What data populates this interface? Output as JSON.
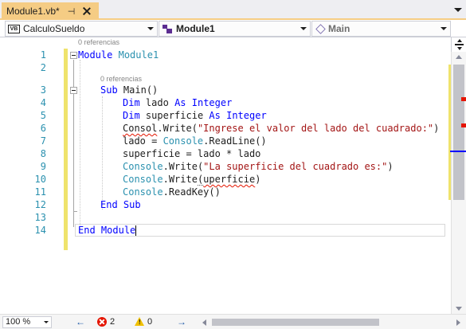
{
  "tab": {
    "title": "Module1.vb*",
    "pin_glyph": "⊣",
    "close_label": "close"
  },
  "navbar": {
    "project": "CalculoSueldo",
    "project_icon_text": "VB",
    "type": "Module1",
    "member": "Main"
  },
  "editor": {
    "codelens_module": "0 referencias",
    "codelens_main": "0 referencias",
    "line_numbers": [
      "1",
      "2",
      "3",
      "4",
      "5",
      "6",
      "7",
      "8",
      "9",
      "10",
      "11",
      "12",
      "13",
      "14"
    ],
    "lines": {
      "l1": {
        "kw": "Module",
        "name": "Module1"
      },
      "l3": {
        "kw": "Sub",
        "name": "Main",
        "tail": "()"
      },
      "l4": {
        "kw1": "Dim",
        "name": "lado",
        "kw2": "As",
        "kw3": "Integer"
      },
      "l5": {
        "kw1": "Dim",
        "name": "superficie",
        "kw2": "As",
        "kw3": "Integer"
      },
      "l6": {
        "obj": "Consol",
        "method": ".Write(",
        "str": "\"Ingrese el valor del lado del cuadrado:\"",
        "tail": ")"
      },
      "l7": {
        "left": "lado = ",
        "obj": "Console",
        "dot": ".",
        "method": "ReadLine",
        "tail": "()"
      },
      "l8": {
        "text": "superficie = lado * lado"
      },
      "l9": {
        "obj": "Console",
        "dot": ".",
        "method": "Write",
        "open": "(",
        "str": "\"La superficie del cuadrado es:\"",
        "tail": ")"
      },
      "l10": {
        "obj": "Console",
        "dot": ".",
        "method": "Write",
        "open": "(",
        "arg": "uperficie",
        "tail": ")"
      },
      "l11": {
        "obj": "Console",
        "dot": ".",
        "method": "ReadKey",
        "tail": "()"
      },
      "l12": {
        "kw1": "End",
        "kw2": "Sub"
      },
      "l14": {
        "kw1": "End",
        "kw2": "Module"
      }
    }
  },
  "statusbar": {
    "zoom": "100 %",
    "errors": "2",
    "warnings": "0"
  },
  "colors": {
    "keyword": "#0000ff",
    "type": "#2b91af",
    "string": "#a31515",
    "tab_active": "#f5cc84",
    "change_bar": "#efe36c",
    "error": "#e51400"
  }
}
